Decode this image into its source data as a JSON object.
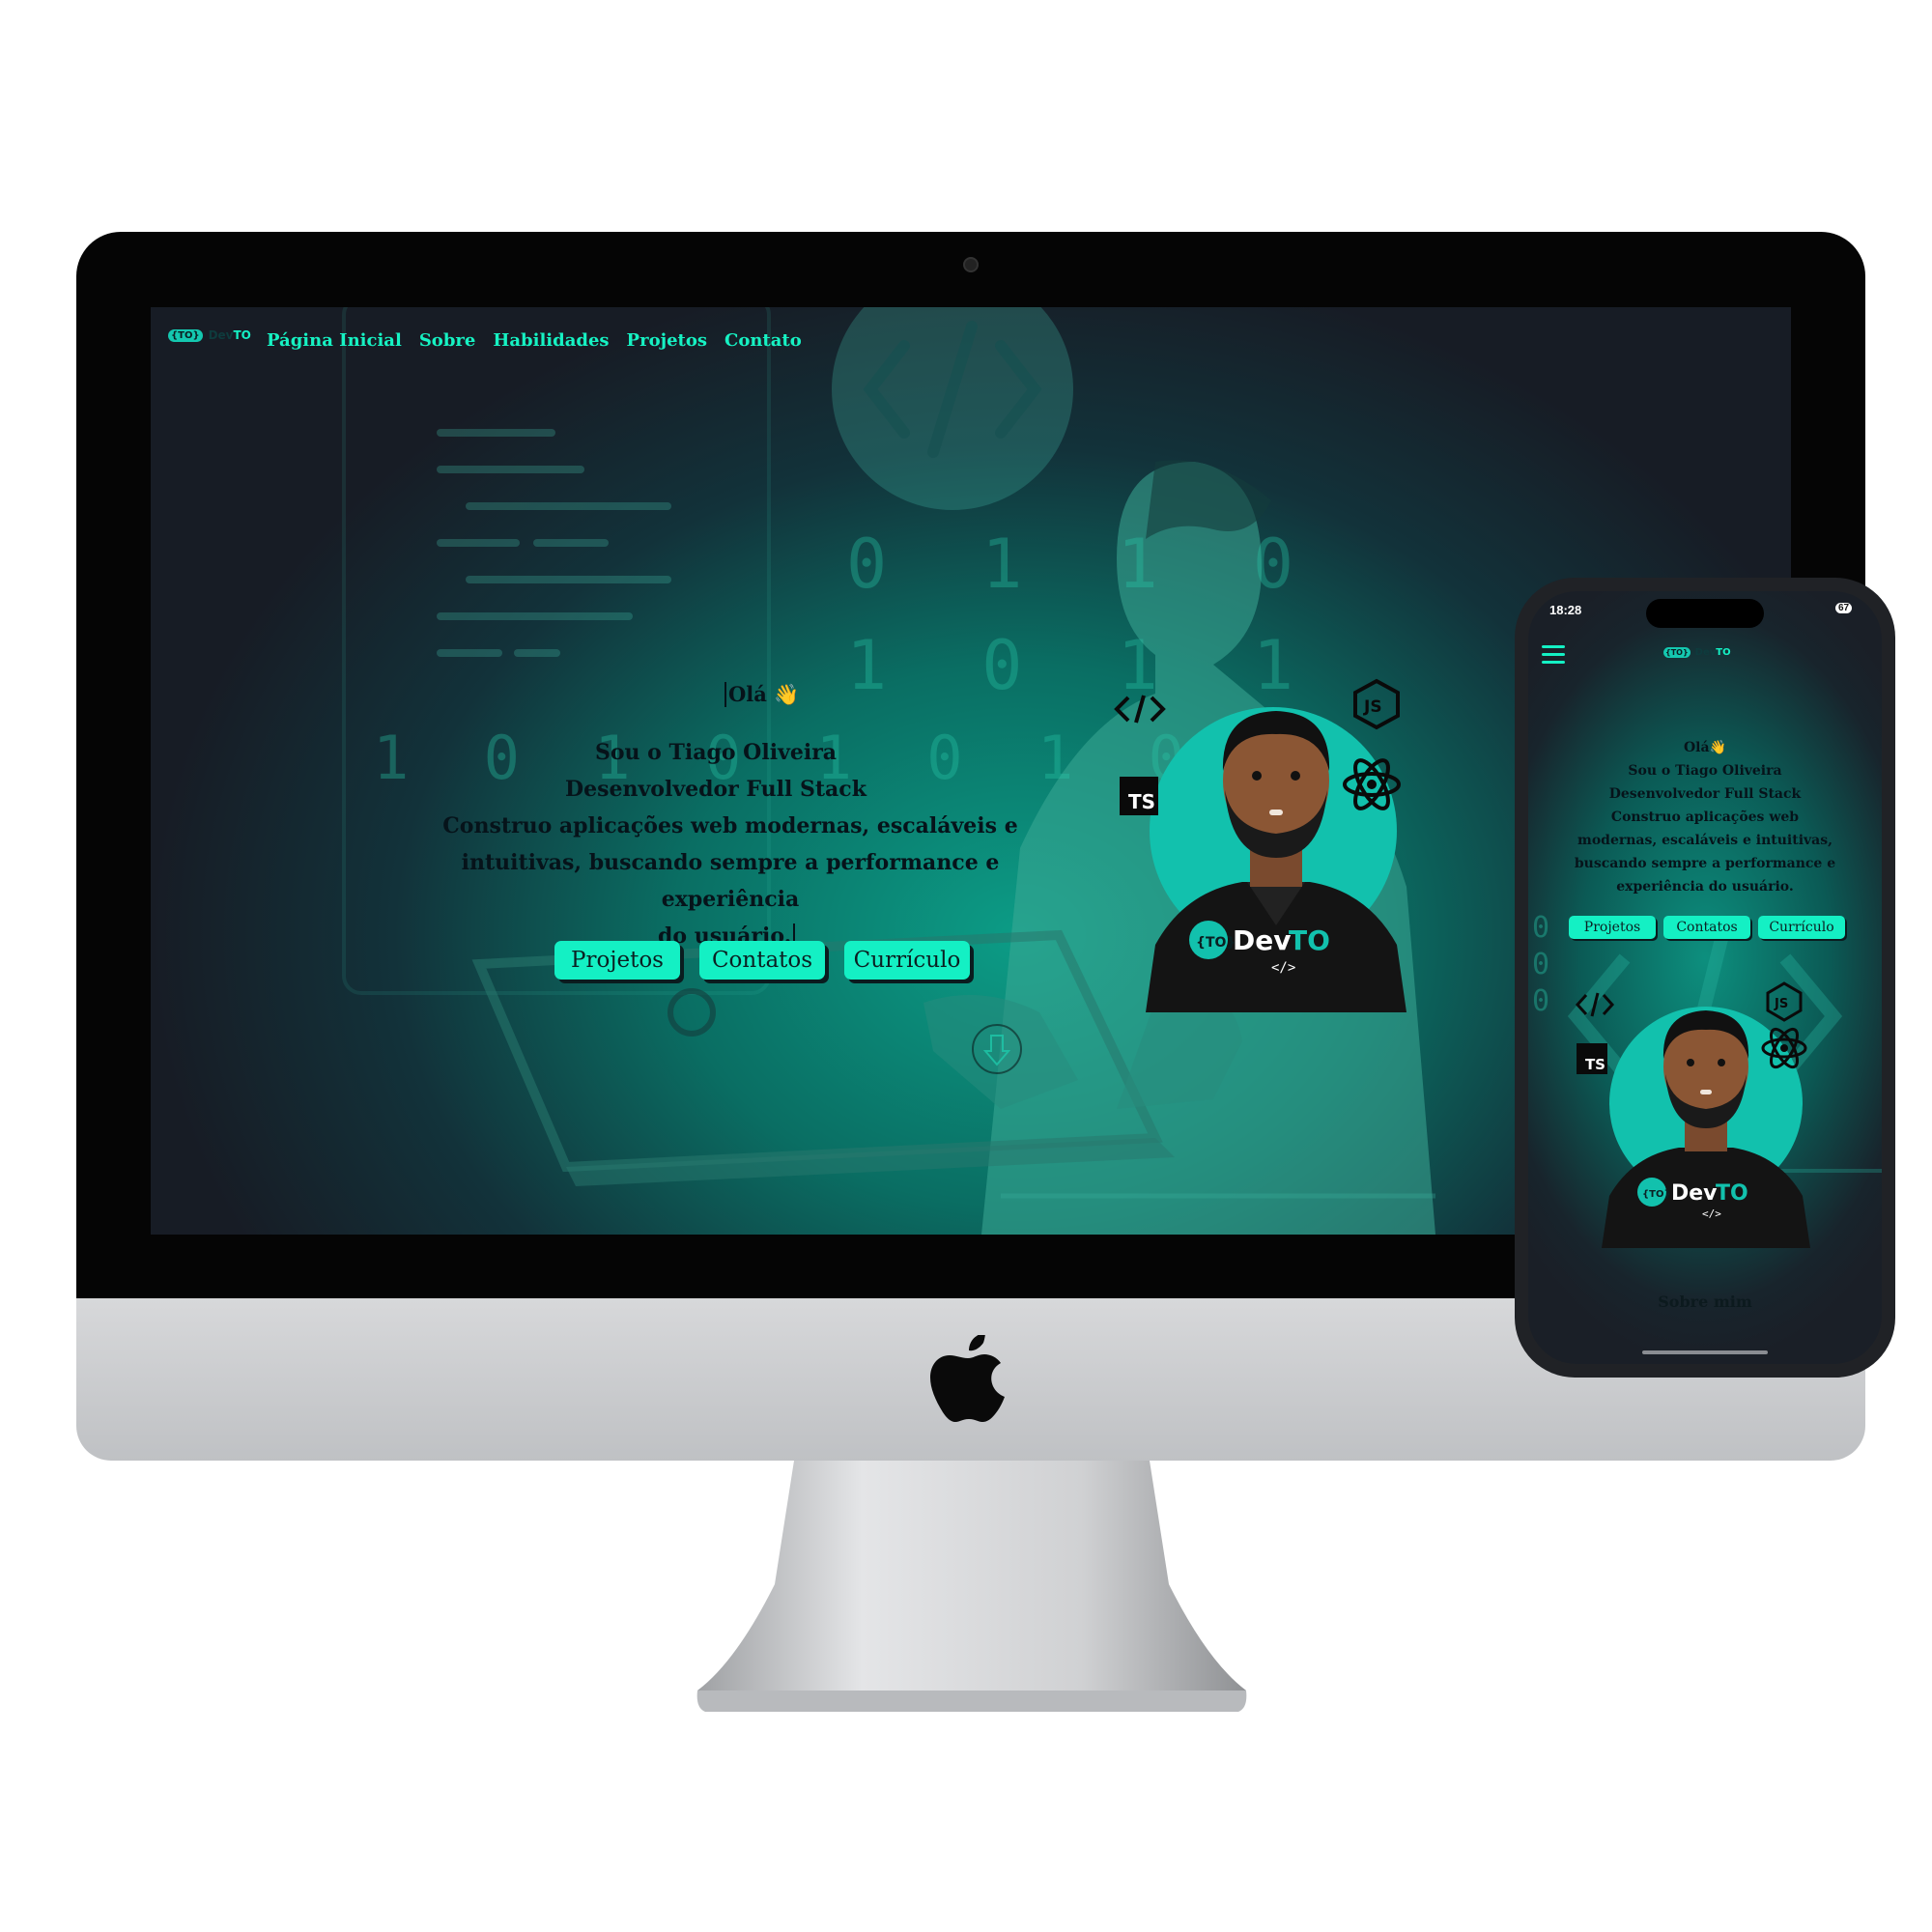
{
  "desktop": {
    "logo": {
      "badge": "{TO}",
      "name_dev": "Dev",
      "name_to": "TO"
    },
    "nav": [
      "Página Inicial",
      "Sobre",
      "Habilidades",
      "Projetos",
      "Contato"
    ],
    "hero": {
      "greeting": "Olá 👋",
      "line1": "Sou o Tiago Oliveira",
      "line2": "Desenvolvedor Full Stack",
      "line3": "Construo aplicações web modernas, escaláveis e",
      "line4": "intuitivas, buscando sempre a performance e experiência",
      "line5": "do usuário."
    },
    "buttons": [
      "Projetos",
      "Contatos",
      "Currículo"
    ],
    "background_binary": [
      "0 1 1 0",
      "1 0 1 1",
      "1 0 1 0 1 0 1 0 1"
    ],
    "avatar": {
      "shirt_badge": "{TO}",
      "shirt_dev": "Dev",
      "shirt_to": "TO",
      "shirt_code": "</>",
      "tech_icons": [
        "code-icon",
        "nodejs-icon",
        "typescript-icon",
        "react-icon"
      ],
      "ts_label": "TS"
    }
  },
  "phone": {
    "status_bar": {
      "time": "18:28",
      "battery": "67"
    },
    "logo": {
      "badge": "{TO}",
      "name_dev": "Dev",
      "name_to": "TO"
    },
    "hero": {
      "greeting": "Olá👋",
      "line1": "Sou o Tiago Oliveira",
      "line2": "Desenvolvedor Full Stack",
      "line3": "Construo aplicações web",
      "line4": "modernas, escaláveis e intuitivas,",
      "line5": "buscando sempre a performance e",
      "line6": "experiência do usuário."
    },
    "buttons": [
      "Projetos",
      "Contatos",
      "Currículo"
    ],
    "section_title": "Sobre mim"
  },
  "colors": {
    "accent": "#14f0c4",
    "screen_bg": "#171c25",
    "teal_glow": "#0c9c86",
    "dark_text": "#06131a"
  }
}
